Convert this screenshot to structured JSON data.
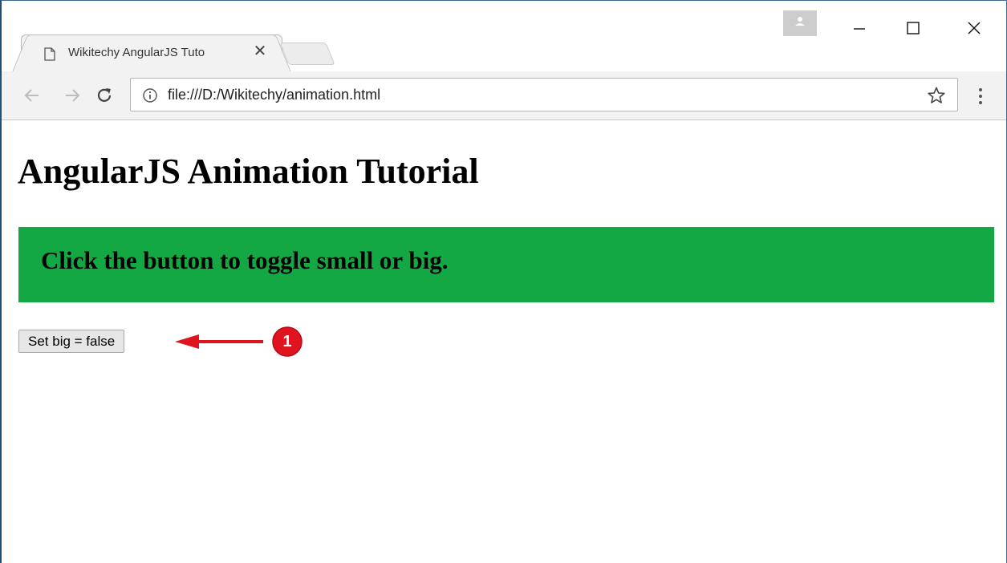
{
  "browser": {
    "tab": {
      "title": "Wikitechy AngularJS Tuto",
      "close_glyph": "✕"
    },
    "address_bar": {
      "url": "file:///D:/Wikitechy/animation.html"
    },
    "icons": {
      "tab_page": "page-icon",
      "profile": "profile-icon",
      "minimize": "minimize-icon",
      "maximize": "maximize-icon",
      "close": "close-icon",
      "back": "back-arrow-icon",
      "forward": "forward-arrow-icon",
      "reload": "reload-icon",
      "info": "info-icon",
      "bookmark": "star-icon",
      "menu": "kebab-menu-icon"
    }
  },
  "page": {
    "title": "AngularJS Animation Tutorial",
    "banner_text": "Click the button to toggle small or big.",
    "banner_color": "#14a845",
    "toggle_button_label": "Set big = false"
  },
  "annotation": {
    "badge_number": "1",
    "color": "#e0141e"
  }
}
